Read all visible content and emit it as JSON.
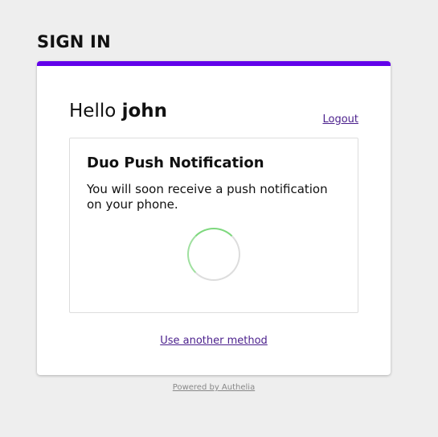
{
  "page": {
    "title": "SIGN IN"
  },
  "colors": {
    "accent": "#6200ea",
    "link": "#4a1f8c",
    "spinner": "#7ed87e"
  },
  "greeting": {
    "prefix": "Hello ",
    "username": "john"
  },
  "logout_label": "Logout",
  "method": {
    "title": "Duo Push Notification",
    "description": "You will soon receive a push notification on your phone.",
    "status_icon": "loading-spinner-icon"
  },
  "another_method_label": "Use another method",
  "footer": {
    "powered_by": "Powered by Authelia"
  }
}
